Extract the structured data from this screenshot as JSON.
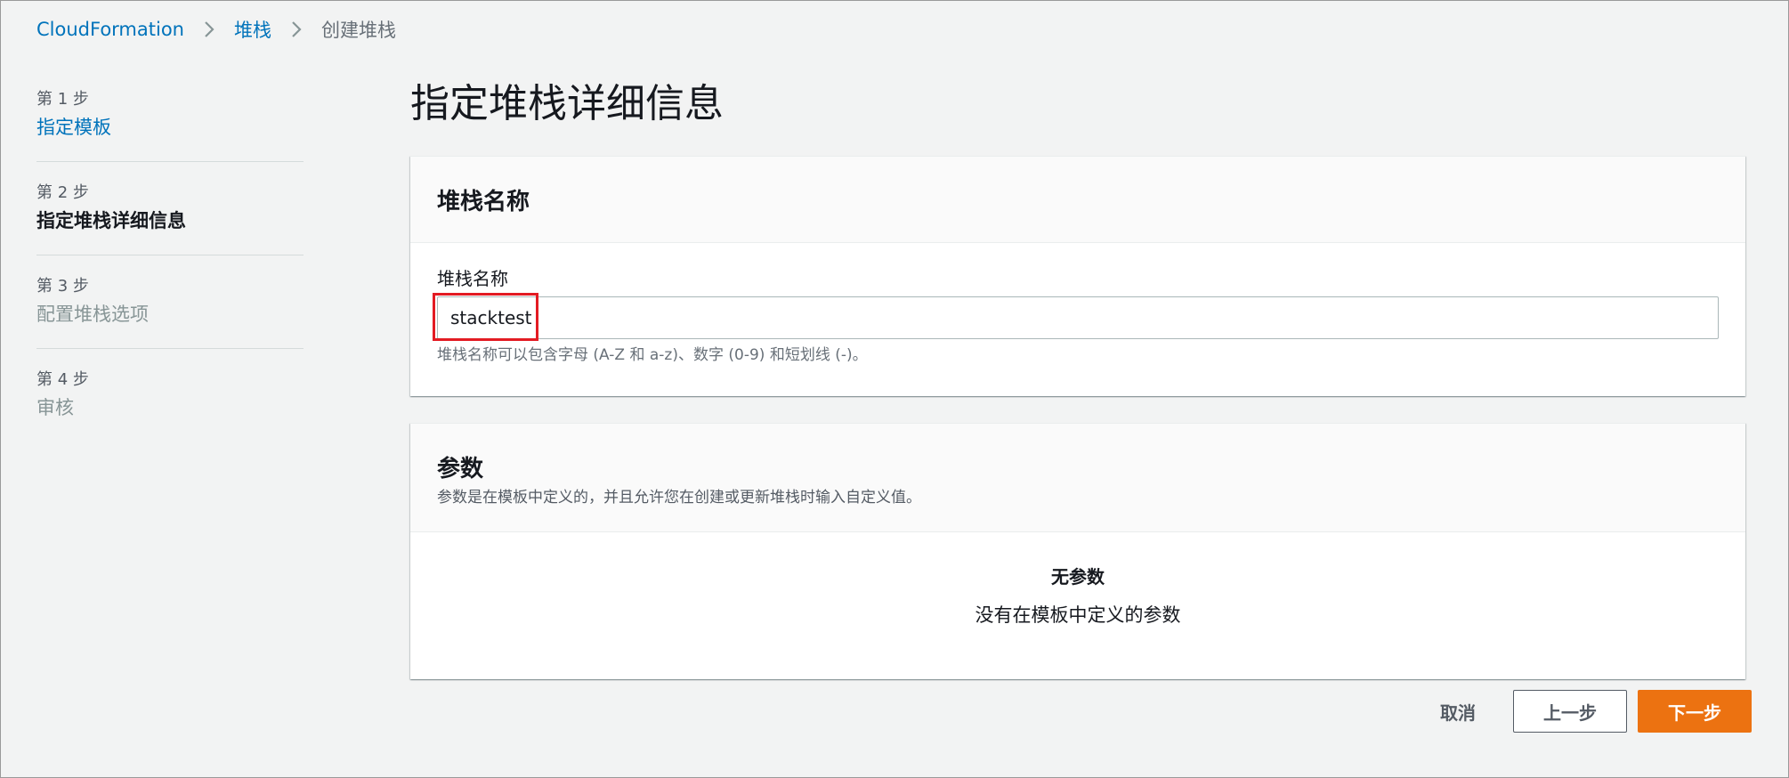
{
  "breadcrumb": {
    "items": [
      {
        "label": "CloudFormation"
      },
      {
        "label": "堆栈"
      },
      {
        "label": "创建堆栈"
      }
    ]
  },
  "steps": [
    {
      "number": "第 1 步",
      "title": "指定模板",
      "state": "link"
    },
    {
      "number": "第 2 步",
      "title": "指定堆栈详细信息",
      "state": "active"
    },
    {
      "number": "第 3 步",
      "title": "配置堆栈选项",
      "state": "disabled"
    },
    {
      "number": "第 4 步",
      "title": "审核",
      "state": "disabled"
    }
  ],
  "page": {
    "title": "指定堆栈详细信息"
  },
  "stack_name_card": {
    "header": "堆栈名称",
    "field_label": "堆栈名称",
    "value": "stacktest",
    "hint": "堆栈名称可以包含字母 (A-Z 和 a-z)、数字 (0-9) 和短划线 (-)。"
  },
  "params_card": {
    "header": "参数",
    "description": "参数是在模板中定义的，并且允许您在创建或更新堆栈时输入自定义值。",
    "empty_title": "无参数",
    "empty_desc": "没有在模板中定义的参数"
  },
  "actions": {
    "cancel_label": "取消",
    "previous_label": "上一步",
    "next_label": "下一步"
  },
  "colors": {
    "link": "#0073bb",
    "primary_button": "#ec7211",
    "highlight": "#e31b23",
    "background": "#f2f3f3"
  }
}
